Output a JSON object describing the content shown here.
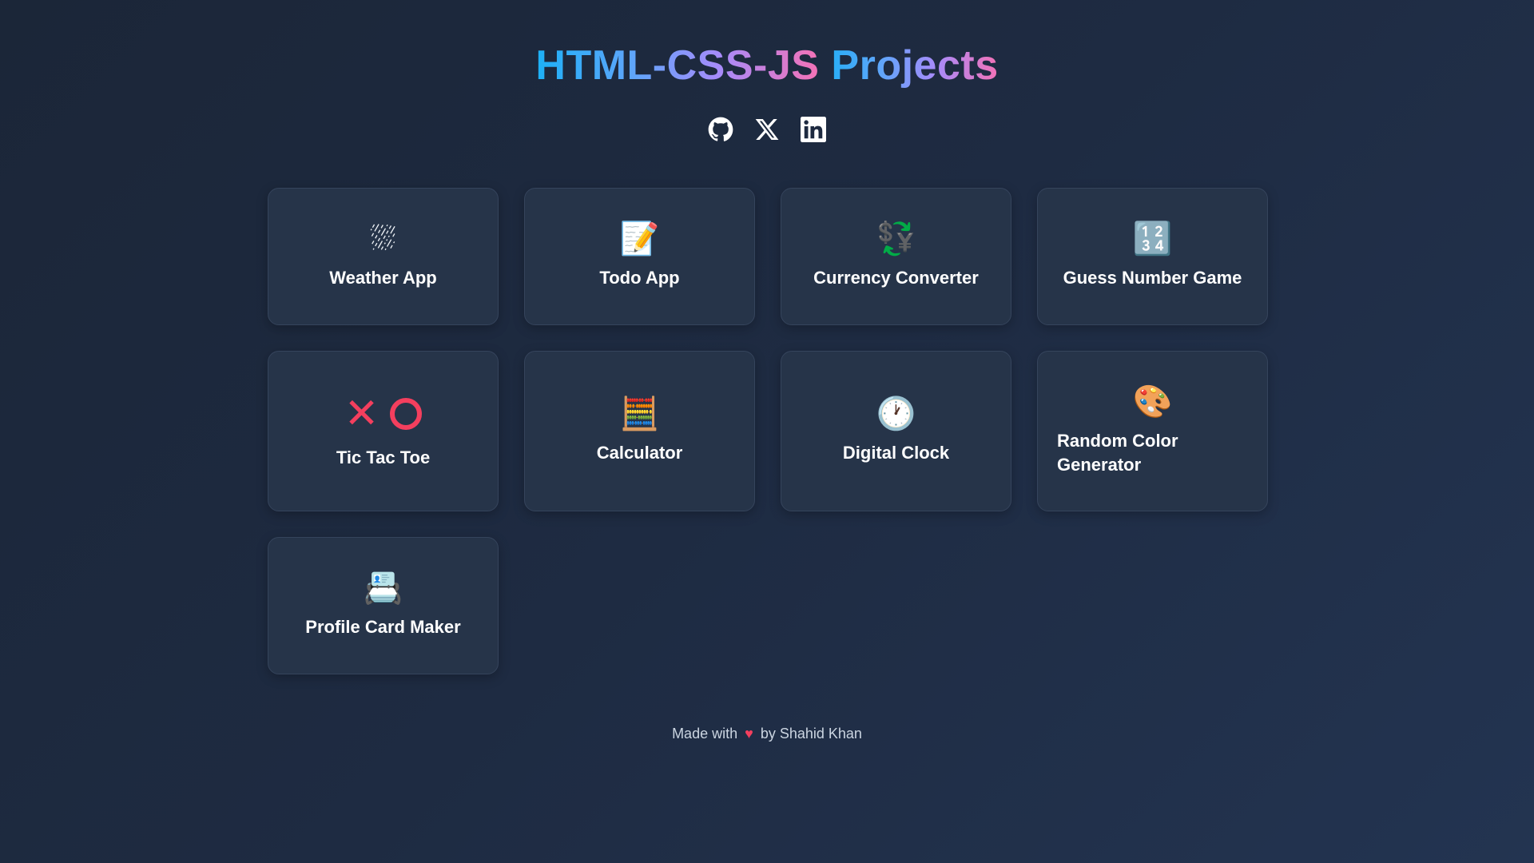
{
  "header": {
    "title_part1": "HTML-CSS-JS",
    "title_part2": " Projects"
  },
  "socials": [
    {
      "name": "GitHub",
      "icon": "github-icon"
    },
    {
      "name": "X",
      "icon": "x-icon"
    },
    {
      "name": "LinkedIn",
      "icon": "linkedin-icon"
    }
  ],
  "projects": [
    {
      "label": "Weather App",
      "icon": "⛆",
      "icon_name": "cloud-rain-icon"
    },
    {
      "label": "Todo App",
      "icon": "📝",
      "icon_name": "memo-icon"
    },
    {
      "label": "Currency Converter",
      "icon": "💱",
      "icon_name": "currency-exchange-icon"
    },
    {
      "label": "Guess Number Game",
      "icon": "🔢",
      "icon_name": "numbers-icon"
    },
    {
      "label": "Tic Tac Toe",
      "icon": "",
      "icon_name": "x-o-icon"
    },
    {
      "label": "Calculator",
      "icon": "🧮",
      "icon_name": "abacus-icon"
    },
    {
      "label": "Digital Clock",
      "icon": "🕐",
      "icon_name": "clock-icon"
    },
    {
      "label": "Random Color Generator",
      "icon": "🎨",
      "icon_name": "palette-icon"
    },
    {
      "label": "Profile Card Maker",
      "icon": "📇",
      "icon_name": "card-index-icon"
    }
  ],
  "footer": {
    "prefix": "Made with",
    "heart": "♥",
    "suffix": "by Shahid Khan"
  },
  "colors": {
    "background": "#1e2b42",
    "card": "#263449",
    "accent_start": "#1cb0f6",
    "accent_end": "#f472b6",
    "heart": "#f43f5e"
  }
}
